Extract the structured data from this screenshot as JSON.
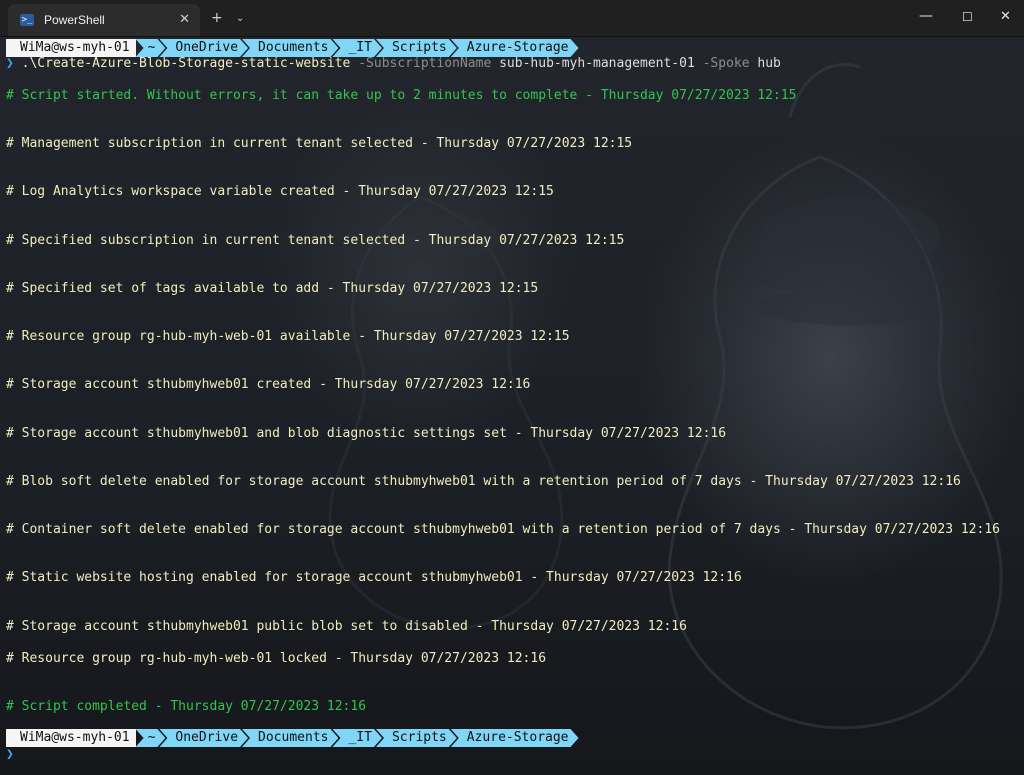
{
  "window": {
    "tab_title": "PowerShell",
    "tab_close": "✕",
    "new_tab": "+",
    "dropdown": "⌄",
    "minimize": "—",
    "maximize": "☐",
    "close": "✕"
  },
  "prompt": {
    "user": "WiMa@ws-myh-01",
    "segments": [
      "~",
      "OneDrive",
      "Documents",
      "_IT",
      "Scripts",
      "Azure-Storage"
    ],
    "symbol": "❯"
  },
  "command": {
    "exe": ".\\Create-Azure-Blob-Storage-static-website",
    "param1": "-SubscriptionName",
    "value1": "sub-hub-myh-management-01",
    "param2": "-Spoke",
    "value2": "hub"
  },
  "output": [
    {
      "text": "# Script started. Without errors, it can take up to 2 minutes to complete - Thursday 07/27/2023 12:15",
      "green": true
    },
    {
      "text": "# Management subscription in current tenant selected - Thursday 07/27/2023 12:15",
      "green": false
    },
    {
      "text": "# Log Analytics workspace variable created - Thursday 07/27/2023 12:15",
      "green": false
    },
    {
      "text": "# Specified subscription in current tenant selected - Thursday 07/27/2023 12:15",
      "green": false
    },
    {
      "text": "# Specified set of tags available to add - Thursday 07/27/2023 12:15",
      "green": false
    },
    {
      "text": "# Resource group rg-hub-myh-web-01 available - Thursday 07/27/2023 12:15",
      "green": false
    },
    {
      "text": "# Storage account sthubmyhweb01 created - Thursday 07/27/2023 12:16",
      "green": false
    },
    {
      "text": "# Storage account sthubmyhweb01 and blob diagnostic settings set - Thursday 07/27/2023 12:16",
      "green": false
    },
    {
      "text": "# Blob soft delete enabled for storage account sthubmyhweb01 with a retention period of 7 days - Thursday 07/27/2023 12:16",
      "green": false
    },
    {
      "text": "# Container soft delete enabled for storage account sthubmyhweb01 with a retention period of 7 days - Thursday 07/27/2023 12:16",
      "green": false
    },
    {
      "text": "# Static website hosting enabled for storage account sthubmyhweb01 - Thursday 07/27/2023 12:16",
      "green": false
    },
    {
      "text": "# Storage account sthubmyhweb01 public blob set to disabled - Thursday 07/27/2023 12:16",
      "green": false
    },
    {
      "text": "# Resource group rg-hub-myh-web-01 locked - Thursday 07/27/2023 12:16",
      "green": false
    },
    {
      "text": "# Script completed - Thursday 07/27/2023 12:16",
      "green": true
    }
  ],
  "colors": {
    "output_text": "#f2ecbc",
    "green_text": "#33c44f",
    "path_segment_bg": "#7fd6f7",
    "user_segment_bg": "#f5f5f5",
    "prompt_arrow": "#3fa9f5"
  }
}
